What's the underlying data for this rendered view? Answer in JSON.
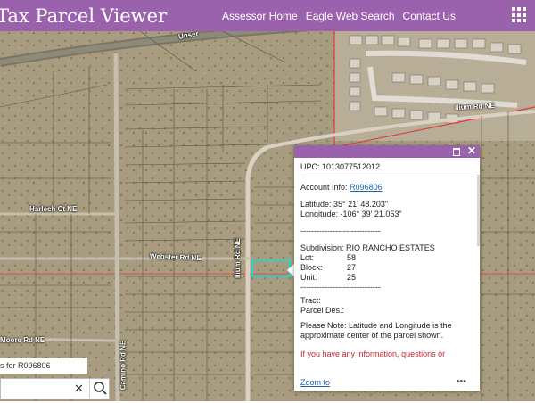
{
  "header": {
    "title": "Tax Parcel Viewer",
    "nav": [
      "Assessor Home",
      "Eagle Web Search",
      "Contact Us"
    ],
    "apps_icon": "grid-icon"
  },
  "map": {
    "road_labels": [
      "Unser",
      "Ilium Rd NE",
      "Harlech Ct NE",
      "Webster Rd NE",
      "Ilium Rd NE",
      "Moore Rd NE",
      "Camino Rd NE"
    ]
  },
  "popup": {
    "upc": "UPC: 1013077512012",
    "account_label": "Account Info:",
    "account_link": "R096806",
    "latitude": "Latitude: 35° 21' 48.203\"",
    "longitude": "Longitude: -106° 39' 21.053\"",
    "divider": "------------------------------",
    "subdivision": "Subdivision: RIO RANCHO ESTATES",
    "lot_label": "Lot:",
    "lot_value": "58",
    "block_label": "Block:",
    "block_value": "27",
    "unit_label": "Unit:",
    "unit_value": "25",
    "divider2": "------------------------------",
    "tract": "Tract:",
    "parcel_des": "Parcel Des.:",
    "note": "Please Note: Latitude and Longitude is the approximate center of the parcel shown.",
    "red_note": "If you have any information, questions or",
    "zoom": "Zoom to",
    "more": "•••"
  },
  "search": {
    "results_text": "s for R096806"
  },
  "colors": {
    "accent": "#9a62ad",
    "link": "#1b62b3",
    "parcel_highlight": "#2ad3c9",
    "boundary_red": "#e03a3a"
  }
}
